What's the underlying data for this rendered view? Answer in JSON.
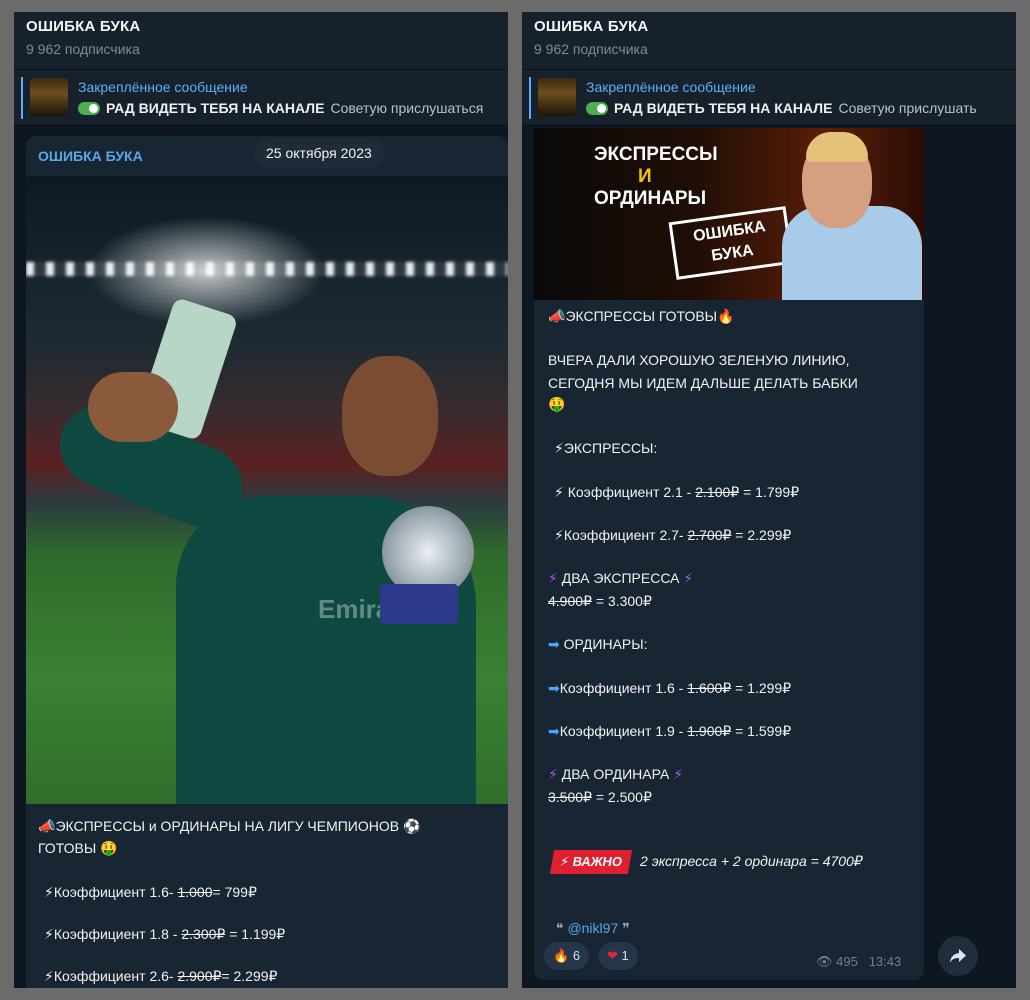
{
  "channel": {
    "title": "ОШИБКА БУКА",
    "subscribers": "9 962 подписчика"
  },
  "pinned": {
    "title": "Закреплённое сообщение",
    "bold_text": "РАД ВИДЕТЬ ТЕБЯ НА КАНАЛЕ",
    "rest_left": "Советую прислушаться",
    "rest_right": "Советую прислушать"
  },
  "left_message": {
    "sender": "ОШИБКА БУКА",
    "date": "25 октября 2023",
    "photo_sponsor": "Emira",
    "headline_1": "ЭКСПРЕССЫ и ОРДИНАРЫ НА ЛИГУ ЧЕМПИОНОВ",
    "headline_2": "ГОТОВЫ",
    "lines": [
      {
        "label": "Коэффициент 1.6- ",
        "old": "1.000",
        "new": "= 799₽"
      },
      {
        "label": "Коэффициент 1.8 - ",
        "old": "2.300₽",
        "new": " = 1.199₽"
      },
      {
        "label": "Коэффициент 2.6- ",
        "old": "2.900₽",
        "new": "= 2.299₽"
      }
    ]
  },
  "right_message": {
    "banner": {
      "line1": "ЭКСПРЕССЫ",
      "line2": "И",
      "line3": "ОРДИНАРЫ",
      "logo_1": "ОШИБКА",
      "logo_2": "БУКА"
    },
    "title": "ЭКСПРЕССЫ ГОТОВЫ",
    "intro_1": "ВЧЕРА ДАЛИ ХОРОШУЮ ЗЕЛЕНУЮ ЛИНИЮ,",
    "intro_2": "СЕГОДНЯ МЫ ИДЕМ ДАЛЬШЕ ДЕЛАТЬ БАБКИ",
    "express_header": "ЭКСПРЕССЫ:",
    "express_1": {
      "label": "Коэффициент 2.1 - ",
      "old": "2.100₽",
      "new": " = 1.799₽"
    },
    "express_2": {
      "label": "Коэффициент 2.7- ",
      "old": "2.700₽",
      "new": " = 2.299₽"
    },
    "two_express": "ДВА ЭКСПРЕССА",
    "two_express_price": {
      "old": "4.900₽",
      "new": " = 3.300₽"
    },
    "ordinar_header": "ОРДИНАРЫ:",
    "ordinar_1": {
      "label": "Коэффициент 1.6 - ",
      "old": "1.600₽",
      "new": " = 1.299₽"
    },
    "ordinar_2": {
      "label": "Коэффициент 1.9 - ",
      "old": "1.900₽",
      "new": " = 1.599₽"
    },
    "two_ordinar": "ДВА ОРДИНАРА",
    "two_ordinar_price": {
      "old": "3.500₽",
      "new": " = 2.500₽"
    },
    "important_badge": "ВАЖНО",
    "important_text": "2 экспресса + 2 ординара  = 4700₽",
    "author": "@nikl97",
    "reactions": [
      {
        "icon": "fire-icon",
        "glyph": "🔥",
        "count": "6"
      },
      {
        "icon": "heart-icon",
        "glyph": "❤",
        "count": "1"
      }
    ],
    "views": "495",
    "time": "13:43"
  },
  "colors": {
    "background": "#0e1621",
    "header": "#17212b",
    "bubble": "#182533",
    "link": "#5aa8e6",
    "important": "#e02030"
  }
}
